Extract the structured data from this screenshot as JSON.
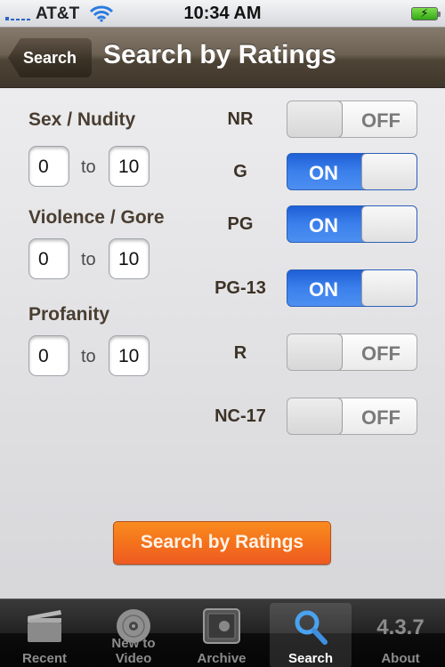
{
  "status_bar": {
    "carrier": "AT&T",
    "time": "10:34 AM",
    "battery": "charging"
  },
  "nav": {
    "back_label": "Search",
    "title": "Search by Ratings"
  },
  "content_filters": [
    {
      "label": "Sex / Nudity",
      "min": "0",
      "to": "to",
      "max": "10"
    },
    {
      "label": "Violence / Gore",
      "min": "0",
      "to": "to",
      "max": "10"
    },
    {
      "label": "Profanity",
      "min": "0",
      "to": "to",
      "max": "10"
    }
  ],
  "ratings": [
    {
      "label": "NR",
      "state": "OFF"
    },
    {
      "label": "G",
      "state": "ON"
    },
    {
      "label": "PG",
      "state": "ON"
    },
    {
      "label": "PG-13",
      "state": "ON"
    },
    {
      "label": "R",
      "state": "OFF"
    },
    {
      "label": "NC-17",
      "state": "OFF"
    }
  ],
  "search_button": "Search by Ratings",
  "tabs": [
    {
      "label": "Recent",
      "icon": "clapperboard-icon"
    },
    {
      "label": "New to Video",
      "icon": "disc-icon"
    },
    {
      "label": "Archive",
      "icon": "safe-icon"
    },
    {
      "label": "Search",
      "icon": "magnifier-icon",
      "selected": true
    },
    {
      "label": "About",
      "icon_text": "4.3.7"
    }
  ],
  "colors": {
    "nav_brown": "#4e4436",
    "label_brown": "#4a3e31",
    "toggle_on_blue": "#3b80ec",
    "search_orange": "#f4721c"
  }
}
